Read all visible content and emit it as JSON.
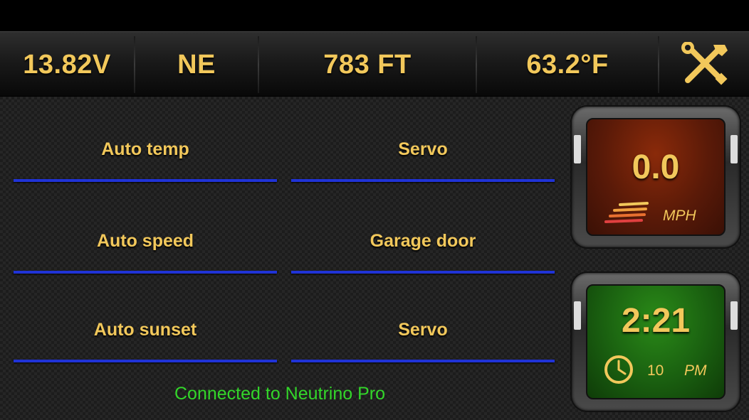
{
  "status_bar": {
    "voltage": "13.82V",
    "heading": "NE",
    "altitude": "783 FT",
    "temperature": "63.2°F",
    "settings_icon": "tools-icon"
  },
  "switches": [
    {
      "label": "Auto temp"
    },
    {
      "label": "Servo"
    },
    {
      "label": "Auto speed"
    },
    {
      "label": "Garage door"
    },
    {
      "label": "Auto sunset"
    },
    {
      "label": "Servo"
    }
  ],
  "connection_status": "Connected to Neutrino Pro",
  "speed_gauge": {
    "value": "0.0",
    "unit": "MPH",
    "icon": "speed-lines-icon"
  },
  "clock_gauge": {
    "time": "2:21",
    "seconds": "10",
    "ampm": "PM",
    "icon": "clock-icon"
  },
  "colors": {
    "accent": "#f2c85b",
    "switch_line": "#2033d6",
    "status_green": "#33d62a"
  }
}
